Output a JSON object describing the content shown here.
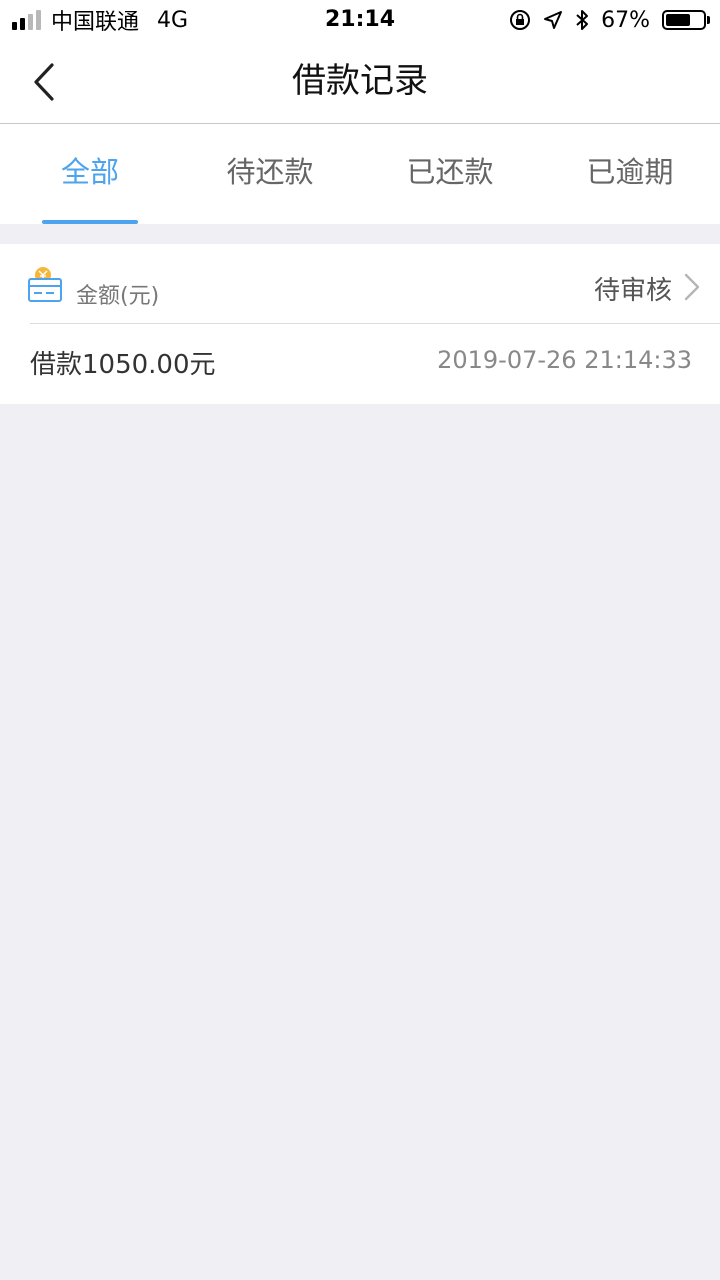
{
  "status_bar": {
    "carrier": "中国联通",
    "network": "4G",
    "time": "21:14",
    "battery": "67%",
    "battery_level": 0.67
  },
  "header": {
    "title": "借款记录",
    "back_icon": "chevron-left-icon"
  },
  "tabs": [
    {
      "label": "全部",
      "active": true
    },
    {
      "label": "待还款",
      "active": false
    },
    {
      "label": "已还款",
      "active": false
    },
    {
      "label": "已逾期",
      "active": false
    }
  ],
  "record": {
    "icon": "wallet-card-icon",
    "amount_label": "金额(元)",
    "status": "待审核",
    "description": "借款1050.00元",
    "time": "2019-07-26 21:14:33"
  },
  "colors": {
    "accent": "#4da3ee",
    "background": "#efeff4",
    "coin": "#f5b63a"
  }
}
